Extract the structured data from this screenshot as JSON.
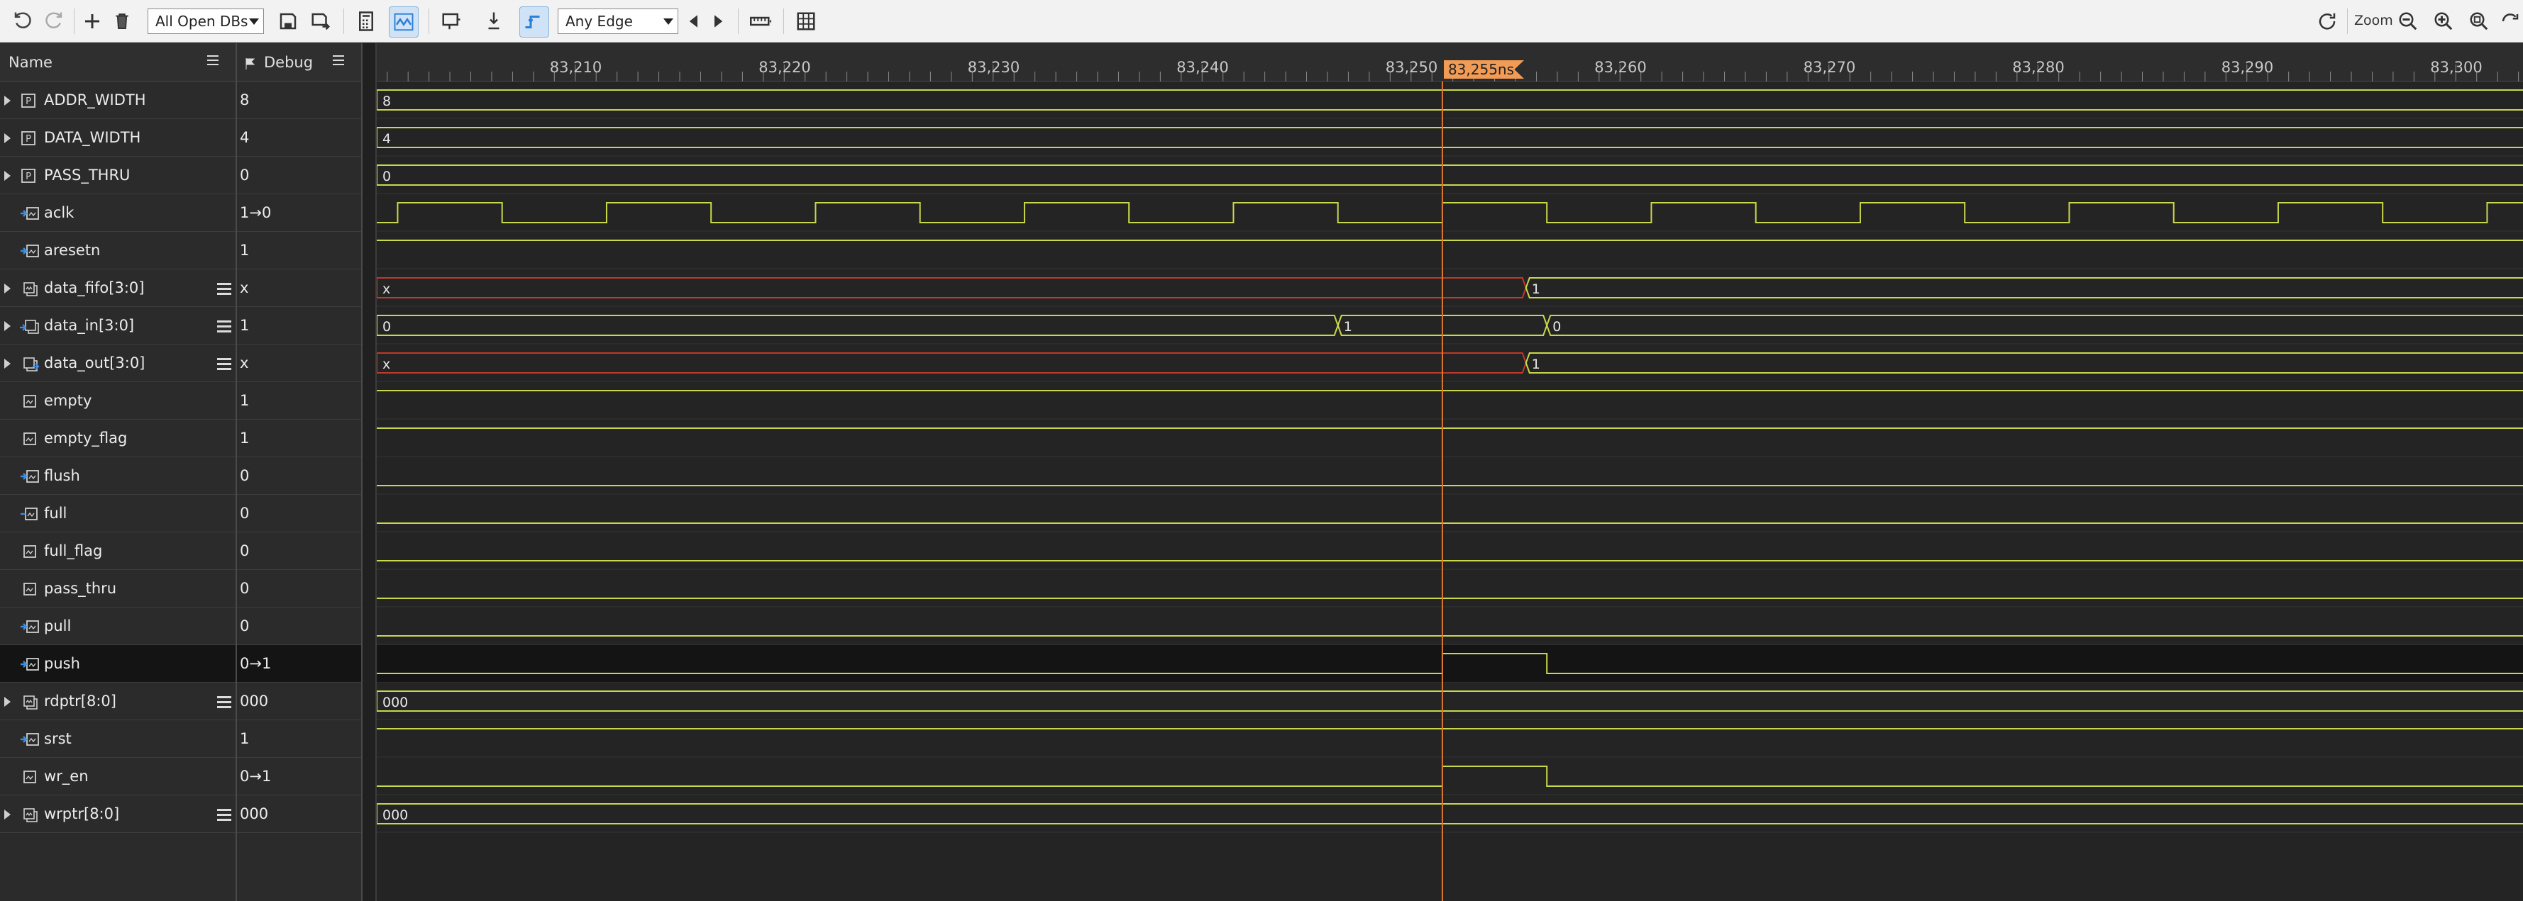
{
  "toolbar": {
    "db_select": "All Open DBs",
    "edge_select": "Any Edge",
    "zoom_label": "Zoom"
  },
  "headers": {
    "name": "Name",
    "value": "Debug"
  },
  "ruler": {
    "ticks": [
      "83,210",
      "83,220",
      "83,230",
      "83,240",
      "83,250",
      "83,260",
      "83,270",
      "83,280",
      "83,290",
      "83,300"
    ],
    "cursor_label": "83,255ns",
    "start_time": 83200.5,
    "ns_per_tick": 10
  },
  "signals": [
    {
      "name": "ADDR_WIDTH",
      "value": "8",
      "kind": "param",
      "expand": true
    },
    {
      "name": "DATA_WIDTH",
      "value": "4",
      "kind": "param",
      "expand": true
    },
    {
      "name": "PASS_THRU",
      "value": "0",
      "kind": "param",
      "expand": true
    },
    {
      "name": "aclk",
      "value": "1→0",
      "kind": "input"
    },
    {
      "name": "aresetn",
      "value": "1",
      "kind": "input"
    },
    {
      "name": "data_fifo[3:0]",
      "value": "x",
      "kind": "bus",
      "expand": true,
      "menu": true
    },
    {
      "name": "data_in[3:0]",
      "value": "1",
      "kind": "busin",
      "expand": true,
      "menu": true
    },
    {
      "name": "data_out[3:0]",
      "value": "x",
      "kind": "busout",
      "expand": true,
      "menu": true
    },
    {
      "name": "empty",
      "value": "1",
      "kind": "wire"
    },
    {
      "name": "empty_flag",
      "value": "1",
      "kind": "wire"
    },
    {
      "name": "flush",
      "value": "0",
      "kind": "input"
    },
    {
      "name": "full",
      "value": "0",
      "kind": "output"
    },
    {
      "name": "full_flag",
      "value": "0",
      "kind": "wire"
    },
    {
      "name": "pass_thru",
      "value": "0",
      "kind": "wire"
    },
    {
      "name": "pull",
      "value": "0",
      "kind": "input"
    },
    {
      "name": "push",
      "value": "0→1",
      "kind": "input",
      "selected": true
    },
    {
      "name": "rdptr[8:0]",
      "value": "000",
      "kind": "bus",
      "expand": true,
      "menu": true
    },
    {
      "name": "srst",
      "value": "1",
      "kind": "input"
    },
    {
      "name": "wr_en",
      "value": "0→1",
      "kind": "wire"
    },
    {
      "name": "wrptr[8:0]",
      "value": "000",
      "kind": "bus",
      "expand": true,
      "menu": true
    }
  ],
  "waves": [
    {
      "type": "bus",
      "segs": [
        {
          "t": 83200.5,
          "v": "8"
        }
      ]
    },
    {
      "type": "bus",
      "segs": [
        {
          "t": 83200.5,
          "v": "4"
        }
      ]
    },
    {
      "type": "bus",
      "segs": [
        {
          "t": 83200.5,
          "v": "0"
        }
      ]
    },
    {
      "type": "clock",
      "first_edge": 83201.5,
      "half_period": 5,
      "initial": 0
    },
    {
      "type": "bit",
      "segs": [
        {
          "t": 83200.5,
          "v": 1
        }
      ]
    },
    {
      "type": "bus",
      "segs": [
        {
          "t": 83200.5,
          "v": "x",
          "x": true
        },
        {
          "t": 83255.5,
          "v": "1"
        }
      ]
    },
    {
      "type": "bus",
      "segs": [
        {
          "t": 83200.5,
          "v": "0"
        },
        {
          "t": 83246.5,
          "v": "1"
        },
        {
          "t": 83256.5,
          "v": "0"
        }
      ]
    },
    {
      "type": "bus",
      "segs": [
        {
          "t": 83200.5,
          "v": "x",
          "x": true
        },
        {
          "t": 83255.5,
          "v": "1"
        }
      ]
    },
    {
      "type": "bit",
      "segs": [
        {
          "t": 83200.5,
          "v": 1
        }
      ]
    },
    {
      "type": "bit",
      "segs": [
        {
          "t": 83200.5,
          "v": 1
        }
      ]
    },
    {
      "type": "bit",
      "segs": [
        {
          "t": 83200.5,
          "v": 0
        }
      ]
    },
    {
      "type": "bit",
      "segs": [
        {
          "t": 83200.5,
          "v": 0
        }
      ]
    },
    {
      "type": "bit",
      "segs": [
        {
          "t": 83200.5,
          "v": 0
        }
      ]
    },
    {
      "type": "bit",
      "segs": [
        {
          "t": 83200.5,
          "v": 0
        }
      ]
    },
    {
      "type": "bit",
      "segs": [
        {
          "t": 83200.5,
          "v": 0
        }
      ]
    },
    {
      "type": "bit",
      "segs": [
        {
          "t": 83200.5,
          "v": 0
        },
        {
          "t": 83251.5,
          "v": 1
        },
        {
          "t": 83256.5,
          "v": 0
        }
      ]
    },
    {
      "type": "bus",
      "segs": [
        {
          "t": 83200.5,
          "v": "000"
        }
      ]
    },
    {
      "type": "bit",
      "segs": [
        {
          "t": 83200.5,
          "v": 1
        }
      ]
    },
    {
      "type": "bit",
      "segs": [
        {
          "t": 83200.5,
          "v": 0
        },
        {
          "t": 83251.5,
          "v": 1
        },
        {
          "t": 83256.5,
          "v": 0
        }
      ]
    },
    {
      "type": "bus",
      "segs": [
        {
          "t": 83200.5,
          "v": "000"
        }
      ]
    }
  ],
  "cursor_time": 83251.5,
  "colors": {
    "wave": "#c9d84a",
    "x_wave": "#c0392b",
    "cursor": "#e0762f",
    "accent": "#2b7fd6"
  }
}
